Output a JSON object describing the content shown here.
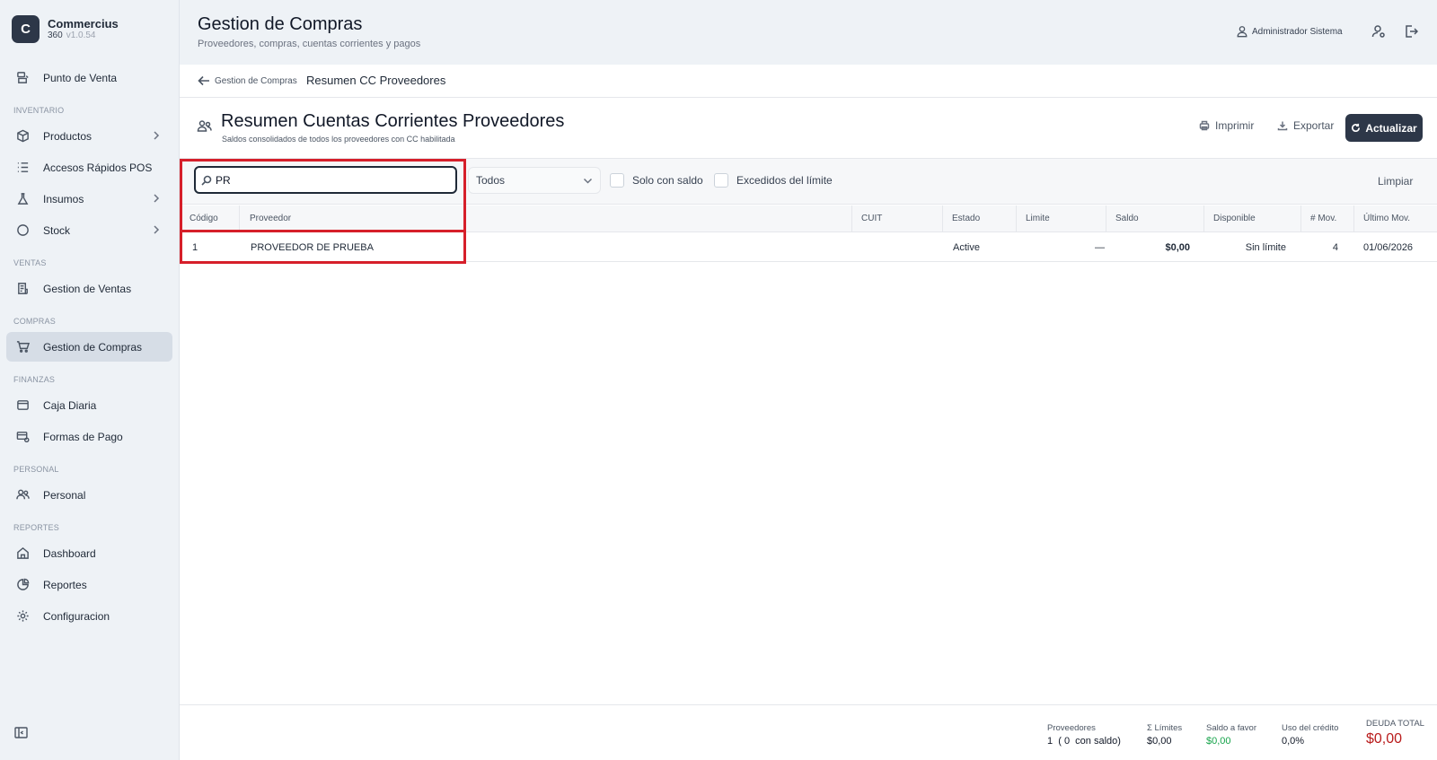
{
  "brand": {
    "logo_letter": "C",
    "name": "Commercius",
    "sub": "360",
    "version": "v1.0.54"
  },
  "sidebar": {
    "items": [
      {
        "label": "Punto de Venta"
      },
      {
        "label": "Productos"
      },
      {
        "label": "Accesos Rápidos POS"
      },
      {
        "label": "Insumos"
      },
      {
        "label": "Stock"
      },
      {
        "label": "Gestion de Ventas"
      },
      {
        "label": "Gestion de Compras"
      },
      {
        "label": "Caja Diaria"
      },
      {
        "label": "Formas de Pago"
      },
      {
        "label": "Personal"
      },
      {
        "label": "Dashboard"
      },
      {
        "label": "Reportes"
      },
      {
        "label": "Configuracion"
      }
    ],
    "sections": {
      "inventario": "INVENTARIO",
      "ventas": "VENTAS",
      "compras": "COMPRAS",
      "finanzas": "FINANZAS",
      "personal": "PERSONAL",
      "reportes": "REPORTES"
    }
  },
  "header": {
    "title": "Gestion de Compras",
    "subtitle": "Proveedores, compras, cuentas corrientes y pagos",
    "user": "Administrador Sistema"
  },
  "breadcrumb": {
    "back_label": "Gestion de Compras",
    "current": "Resumen CC Proveedores"
  },
  "section": {
    "title": "Resumen Cuentas Corrientes Proveedores",
    "subtitle": "Saldos consolidados de todos los proveedores con CC habilitada",
    "print_label": "Imprimir",
    "export_label": "Exportar",
    "refresh_label": "Actualizar"
  },
  "filters": {
    "search_value": "PR",
    "status_select": "Todos",
    "only_balance_label": "Solo con saldo",
    "over_limit_label": "Excedidos del límite",
    "clear_label": "Limpiar"
  },
  "table": {
    "columns": [
      "Código",
      "Proveedor",
      "CUIT",
      "Estado",
      "Limite",
      "Saldo",
      "Disponible",
      "# Mov.",
      "Último Mov."
    ],
    "rows": [
      {
        "codigo": "1",
        "proveedor": "PROVEEDOR DE PRUEBA",
        "cuit": "",
        "estado": "Active",
        "limite": "—",
        "saldo": "$0,00",
        "disponible": "Sin límite",
        "movs": "4",
        "ultimo": "01/06/2026"
      }
    ]
  },
  "footer": {
    "proveedores_label": "Proveedores",
    "proveedores_value": "1  ( 0  con saldo)",
    "limites_label": "Σ Límites",
    "limites_value": "$0,00",
    "favor_label": "Saldo a favor",
    "favor_value": "$0,00",
    "uso_label": "Uso del crédito",
    "uso_value": "0,0%",
    "deuda_label": "DEUDA TOTAL",
    "deuda_value": "$0,00"
  },
  "colors": {
    "accent": "#2d3748",
    "highlight": "#d61f2a",
    "positive": "#16a34a",
    "debt": "#b91c1c"
  }
}
